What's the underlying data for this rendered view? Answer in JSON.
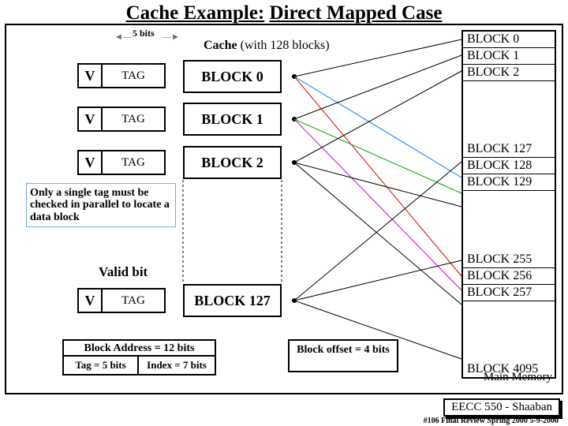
{
  "title_a": "Cache Example:",
  "title_b": "Direct Mapped Case",
  "bits_label": "5 bits",
  "cache_label_bold": "Cache",
  "cache_label_rest": " (with 128 blocks)",
  "rows": {
    "v": "V",
    "tag": "TAG"
  },
  "blocks": {
    "b0": "BLOCK 0",
    "b1": "BLOCK 1",
    "b2": "BLOCK 2",
    "b127": "BLOCK 127"
  },
  "callout": "Only a single tag must be checked in parallel to locate a data block",
  "valid_bit": "Valid bit",
  "mem": {
    "m0": "BLOCK 0",
    "m1": "BLOCK 1",
    "m2": "BLOCK 2",
    "m127": "BLOCK 127",
    "m128": "BLOCK 128",
    "m129": "BLOCK 129",
    "m255": "BLOCK 255",
    "m256": "BLOCK 256",
    "m257": "BLOCK 257",
    "m4095": "BLOCK 4095"
  },
  "mem_label": "Main Memory",
  "addr": {
    "top": "Block Address = 12 bits",
    "tag": "Tag = 5 bits",
    "index": "Index = 7 bits",
    "offset": "Block offset = 4 bits"
  },
  "footer1": "EECC 550 - Shaaban",
  "footer2": "#106  Final Review  Spring 2000  5-9-2000"
}
